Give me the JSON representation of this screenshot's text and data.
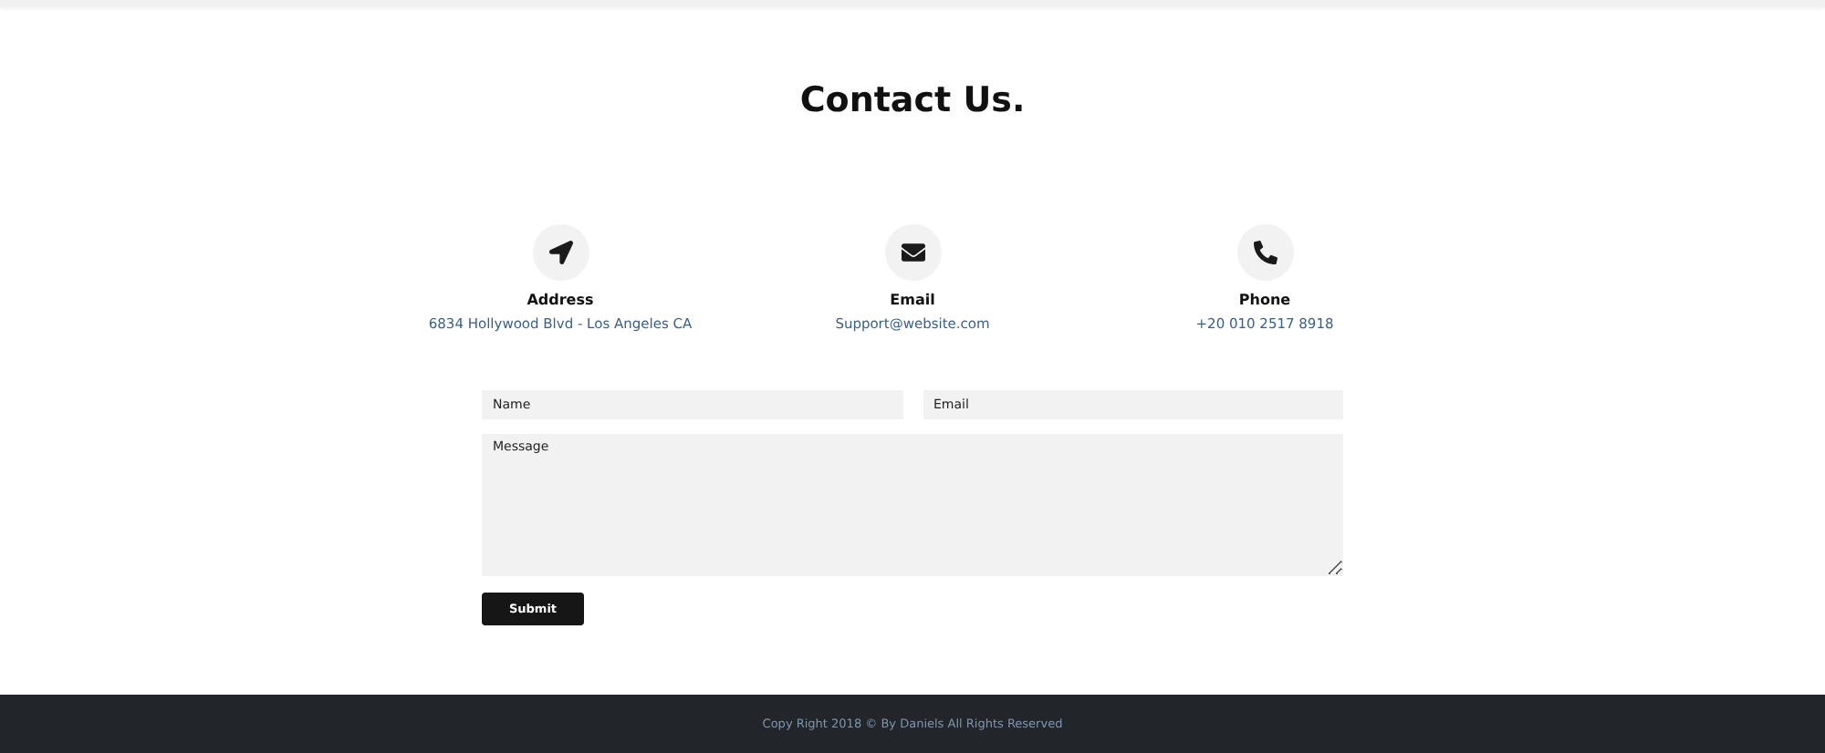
{
  "title": "Contact Us.",
  "contacts": [
    {
      "kind": "address",
      "label": "Address",
      "value": "6834 Hollywood Blvd - Los Angeles CA"
    },
    {
      "kind": "email",
      "label": "Email",
      "value": "Support@website.com"
    },
    {
      "kind": "phone",
      "label": "Phone",
      "value": "+20 010 2517 8918"
    }
  ],
  "form": {
    "name": {
      "placeholder": "Name"
    },
    "email": {
      "placeholder": "Email"
    },
    "message": {
      "placeholder": "Message"
    },
    "submit": "Submit"
  },
  "footer": "Copy Right 2018 © By Daniels All Rights Reserved"
}
